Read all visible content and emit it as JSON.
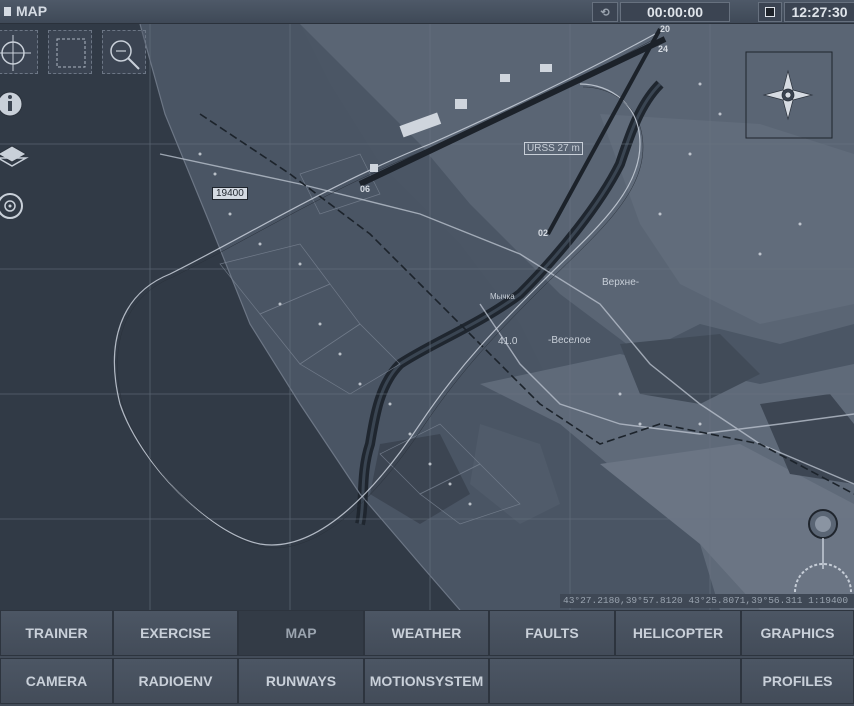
{
  "window": {
    "title": "MAP"
  },
  "toolbar": {
    "timer": "00:00:00",
    "clock": "12:27:30",
    "reset_label": "⟲"
  },
  "map": {
    "labels": {
      "dist1": "19400",
      "dist2": "41.0",
      "place1": "Верхне-",
      "place2": "-Веселое",
      "place3": "Мычка",
      "runway_ref": "URSS 27 m",
      "rw_a": "06",
      "rw_b": "02",
      "rw_c": "20",
      "rw_d": "24"
    }
  },
  "coords": "43°27.2180,39°57.8120 43°25.8071,39°56.311  1:19400",
  "nav": {
    "row1": [
      "TRAINER",
      "EXERCISE",
      "MAP",
      "WEATHER",
      "FAULTS",
      "HELICOPTER",
      "GRAPHICS"
    ],
    "row2": [
      "CAMERA",
      "RADIOENV",
      "RUNWAYS",
      "MOTIONSYSTEM",
      "",
      "",
      "PROFILES"
    ],
    "active": "MAP"
  }
}
